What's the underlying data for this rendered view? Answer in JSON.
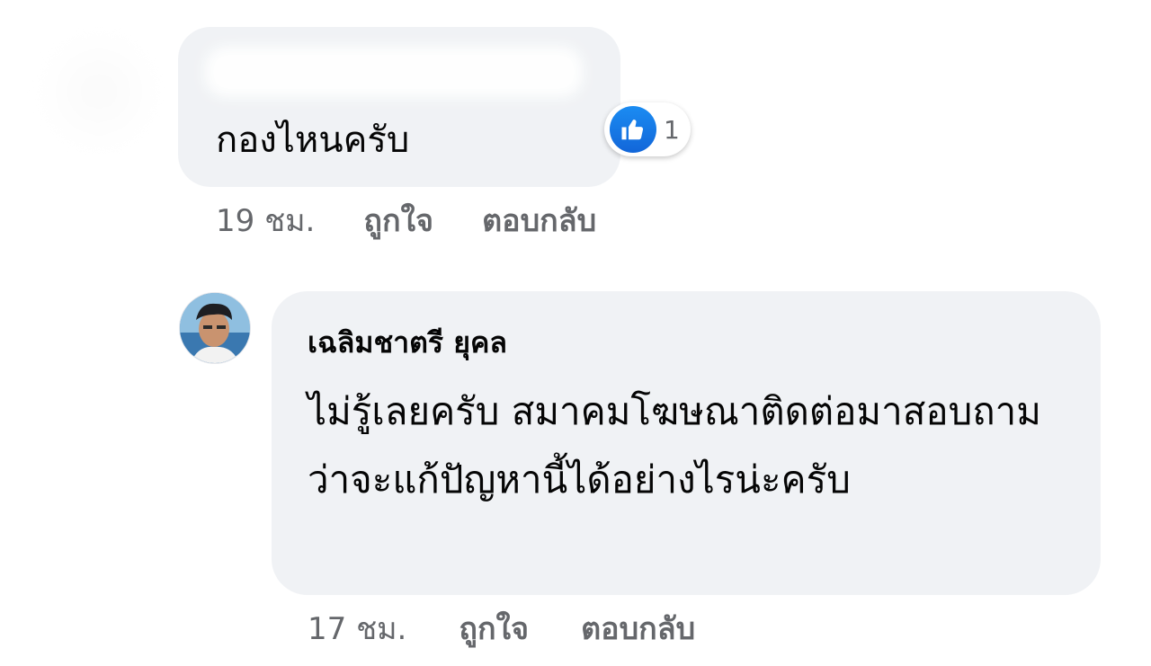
{
  "comment": {
    "text": "กองไหนครับ",
    "reactions": {
      "icon": "thumbs-up-icon",
      "count": "1",
      "color": "#1877f2"
    },
    "time": "19 ชม.",
    "like_label": "ถูกใจ",
    "reply_label": "ตอบกลับ"
  },
  "reply": {
    "author": "เฉลิมชาตรี ยุคล",
    "text": "ไม่รู้เลยครับ สมาคมโฆษณาติดต่อมาสอบถามว่าจะแก้ปัญหานี้ได้อย่างไรน่ะครับ",
    "time": "17 ชม.",
    "like_label": "ถูกใจ",
    "reply_label": "ตอบกลับ"
  }
}
